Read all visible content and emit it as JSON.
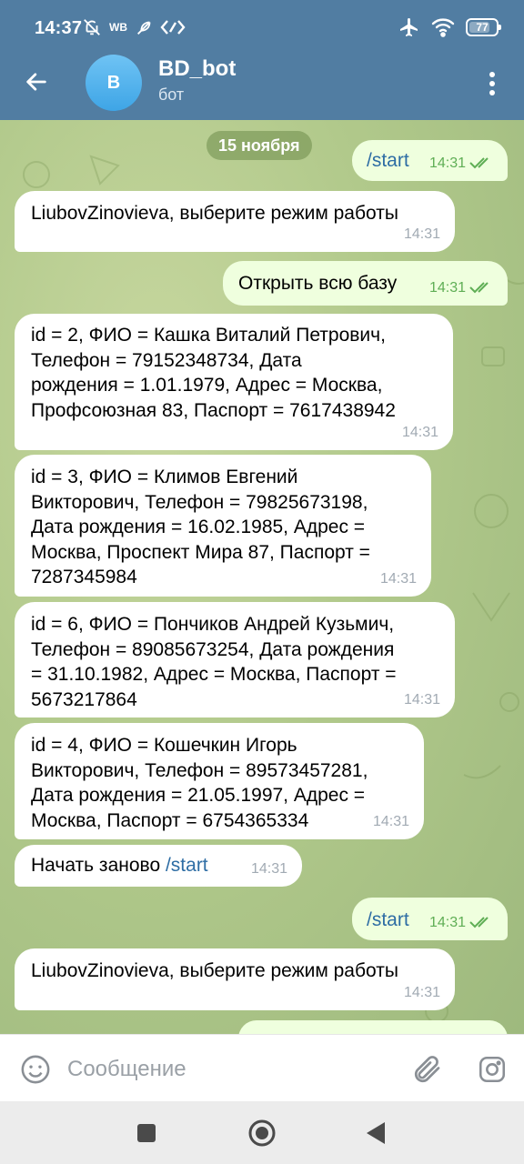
{
  "status_bar": {
    "time": "14:37",
    "carrier_badge": "WB",
    "battery": "77",
    "battery_level": 0.77,
    "icons": [
      "mute-bell-icon",
      "feather-icon",
      "link-icon",
      "airplane-icon",
      "wifi-icon",
      "battery-icon"
    ]
  },
  "chat_header": {
    "avatar_letter": "B",
    "title": "BD_bot",
    "subtitle": "бот"
  },
  "date_separator": "15 ноября",
  "messages": [
    {
      "direction": "out",
      "text": "/start",
      "is_command": true,
      "time": "14:31",
      "read": true
    },
    {
      "direction": "in",
      "text": "LiubovZinovieva, выберите режим работы",
      "time": "14:31"
    },
    {
      "direction": "out",
      "text": "Открыть всю базу",
      "time": "14:31",
      "read": true
    },
    {
      "direction": "in",
      "text": "id = 2, ФИО = Кашка Виталий Петрович,\nТелефон = 79152348734, Дата\nрождения = 1.01.1979, Адрес = Москва,\nПрофсоюзная 83, Паспорт = 7617438942",
      "time": "14:31"
    },
    {
      "direction": "in",
      "text": "id = 3, ФИО = Климов Евгений\nВикторович, Телефон = 79825673198,\nДата рождения = 16.02.1985, Адрес =\nМосква, Проспект Мира 87, Паспорт =\n7287345984",
      "time": "14:31"
    },
    {
      "direction": "in",
      "text": "id = 6, ФИО = Пончиков Андрей Кузьмич,\nТелефон = 89085673254, Дата рождения\n= 31.10.1982, Адрес = Москва, Паспорт =\n5673217864",
      "time": "14:31"
    },
    {
      "direction": "in",
      "text": "id = 4, ФИО = Кошечкин Игорь\nВикторович, Телефон = 89573457281,\nДата рождения = 21.05.1997, Адрес =\nМосква, Паспорт = 6754365334",
      "time": "14:31"
    },
    {
      "direction": "in",
      "text_prefix": "Начать заново ",
      "command": "/start",
      "time": "14:31"
    },
    {
      "direction": "out",
      "text": "/start",
      "is_command": true,
      "time": "14:31",
      "read": true
    },
    {
      "direction": "in",
      "text": "LiubovZinovieva, выберите режим работы",
      "time": "14:31"
    }
  ],
  "composer": {
    "placeholder": "Сообщение"
  },
  "colors": {
    "header": "#517da2",
    "incoming_bubble": "#ffffff",
    "outgoing_bubble": "#efffde",
    "check_marks": "#5fae55",
    "command_link": "#2e6da4"
  }
}
